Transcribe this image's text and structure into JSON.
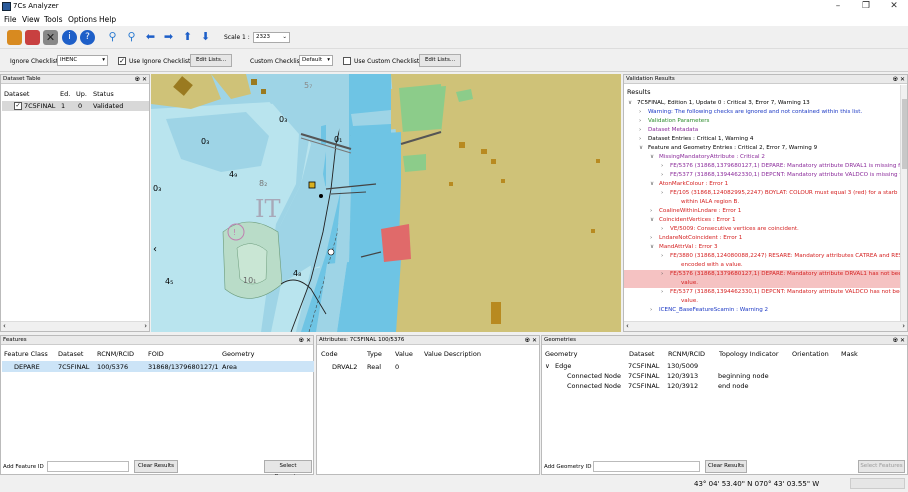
{
  "app": {
    "title": "7Cs Analyzer"
  },
  "menu": [
    "File",
    "View",
    "Tools",
    "Options",
    "Help"
  ],
  "toolbar": {
    "scale_label": "Scale 1 :",
    "scale_value": "2323"
  },
  "checklist_bar": {
    "ignore_label": "Ignore Checklist",
    "ignore_value": "IHENC",
    "use_ignore_label": "Use Ignore Checklist",
    "edit_lists_1": "Edit Lists...",
    "custom_label": "Custom Checklist",
    "custom_value": "Default",
    "use_custom_label": "Use Custom Checklist",
    "edit_lists_2": "Edit Lists..."
  },
  "dataset_table": {
    "title": "Dataset Table",
    "headers": [
      "Dataset",
      "Ed.",
      "Up.",
      "Status"
    ],
    "rows": [
      {
        "dataset": "7C5FINAL",
        "ed": "1",
        "up": "0",
        "status": "Validated"
      }
    ]
  },
  "map": {
    "depths": [
      "5₇",
      "0₃",
      "0₁",
      "0₃",
      "4₉",
      "8₂",
      "0₃",
      "4₅",
      "10₁",
      "4₈"
    ],
    "area_label": "IT"
  },
  "validation": {
    "title": "Validation Results",
    "results_label": "Results",
    "lines": [
      {
        "t": "7C5FINAL, Edition 1, Update 0 : Critical 3, Error 7, Warning 13",
        "c": "#000",
        "ind": 0,
        "ex": "∨"
      },
      {
        "t": "Warning: The following checks are ignored and not contained within this list.",
        "c": "#1a37c4",
        "ind": 1,
        "ex": "›"
      },
      {
        "t": "Validation Parameters",
        "c": "#2a8a2a",
        "ind": 1,
        "ex": "›"
      },
      {
        "t": "Dataset Metadata",
        "c": "#8a2a9a",
        "ind": 1,
        "ex": "›"
      },
      {
        "t": "Dataset Entries : Critical 1, Warning 4",
        "c": "#000",
        "ind": 1,
        "ex": "›"
      },
      {
        "t": "Feature and Geometry Entries : Critical 2, Error 7, Warning 9",
        "c": "#000",
        "ind": 1,
        "ex": "∨"
      },
      {
        "t": "MissingMandatoryAttribute : Critical 2",
        "c": "#8a2a9a",
        "ind": 2,
        "ex": "∨"
      },
      {
        "t": "FE/5376 (31868,1379680127,1) DEPARE: Mandatory attribute DRVAL1 is missing f",
        "c": "#8a2a9a",
        "ind": 3,
        "ex": "›"
      },
      {
        "t": "FE/5377 (31868,1394462330,1) DEPCNT: Mandatory attribute VALDCO is missing f",
        "c": "#8a2a9a",
        "ind": 3,
        "ex": "›"
      },
      {
        "t": "AtonMarkColour : Error 1",
        "c": "#d42020",
        "ind": 2,
        "ex": "∨"
      },
      {
        "t": "FE/105 (31868,124082995,2247) BOYLAT: COLOUR must equal 3 (red) for a starb",
        "c": "#d42020",
        "ind": 3,
        "ex": "›"
      },
      {
        "t": "within IALA region B.",
        "c": "#d42020",
        "ind": 4,
        "ex": ""
      },
      {
        "t": "CoalineWithinLndare : Error 1",
        "c": "#d42020",
        "ind": 2,
        "ex": "›"
      },
      {
        "t": "CoincidentVertices : Error 1",
        "c": "#d42020",
        "ind": 2,
        "ex": "∨"
      },
      {
        "t": "VE/5009: Consecutive vertices are coincident.",
        "c": "#d42020",
        "ind": 3,
        "ex": "›"
      },
      {
        "t": "LndareNotCoincident : Error 1",
        "c": "#d42020",
        "ind": 2,
        "ex": "›"
      },
      {
        "t": "MandAttrVal : Error 3",
        "c": "#d42020",
        "ind": 2,
        "ex": "∨"
      },
      {
        "t": "FE/3880 (31868,124080088,2247) RESARE: Mandatory attributes CATREA and RES",
        "c": "#d42020",
        "ind": 3,
        "ex": "›"
      },
      {
        "t": "encoded with a value.",
        "c": "#d42020",
        "ind": 4,
        "ex": ""
      },
      {
        "t": "FE/5376 (31868,1379680127,1) DEPARE: Mandatory attribute DRVAL1 has not bee",
        "c": "#d42020",
        "ind": 3,
        "ex": "›",
        "hl": true
      },
      {
        "t": "value.",
        "c": "#d42020",
        "ind": 4,
        "ex": "",
        "hl": true
      },
      {
        "t": "FE/5377 (31868,1394462330,1) DEPCNT: Mandatory attribute VALDCO has not bee",
        "c": "#d42020",
        "ind": 3,
        "ex": "›"
      },
      {
        "t": "value.",
        "c": "#d42020",
        "ind": 4,
        "ex": ""
      },
      {
        "t": "ICENC_BaseFeatureScamin : Warning 2",
        "c": "#1a37c4",
        "ind": 2,
        "ex": "›"
      }
    ]
  },
  "features": {
    "title": "Features",
    "headers": [
      "Feature Class",
      "Dataset",
      "RCNM/RCID",
      "FOID",
      "Geometry"
    ],
    "rows": [
      {
        "cls": "DEPARE",
        "ds": "7C5FINAL",
        "rc": "100/5376",
        "foid": "31868/1379680127/1",
        "geom": "Area"
      }
    ],
    "add_label": "Add Feature ID",
    "clear": "Clear Results",
    "select": "Select Geometry"
  },
  "attributes": {
    "title": "Attributes: 7C5FINAL 100/5376",
    "headers": [
      "Code",
      "Type",
      "Value",
      "Value Description"
    ],
    "rows": [
      {
        "code": "DRVAL2",
        "type": "Real",
        "value": "0",
        "desc": ""
      }
    ]
  },
  "geometries": {
    "title": "Geometries",
    "headers": [
      "Geometry",
      "Dataset",
      "RCNM/RCID",
      "Topology Indicator",
      "Orientation",
      "Mask"
    ],
    "rows": [
      {
        "g": "Edge",
        "ds": "7C5FINAL",
        "rc": "130/5009",
        "ti": "",
        "or": "",
        "mk": "",
        "ind": 0,
        "ex": "∨"
      },
      {
        "g": "Connected Node",
        "ds": "7C5FINAL",
        "rc": "120/3913",
        "ti": "beginning node",
        "or": "",
        "mk": "",
        "ind": 1,
        "ex": ""
      },
      {
        "g": "Connected Node",
        "ds": "7C5FINAL",
        "rc": "120/3912",
        "ti": "end node",
        "or": "",
        "mk": "",
        "ind": 1,
        "ex": ""
      }
    ],
    "add_label": "Add Geometry ID",
    "clear": "Clear Results",
    "select": "Select Features"
  },
  "status": {
    "coords": "43° 04' 53.40\" N  070° 43' 03.55\" W"
  }
}
